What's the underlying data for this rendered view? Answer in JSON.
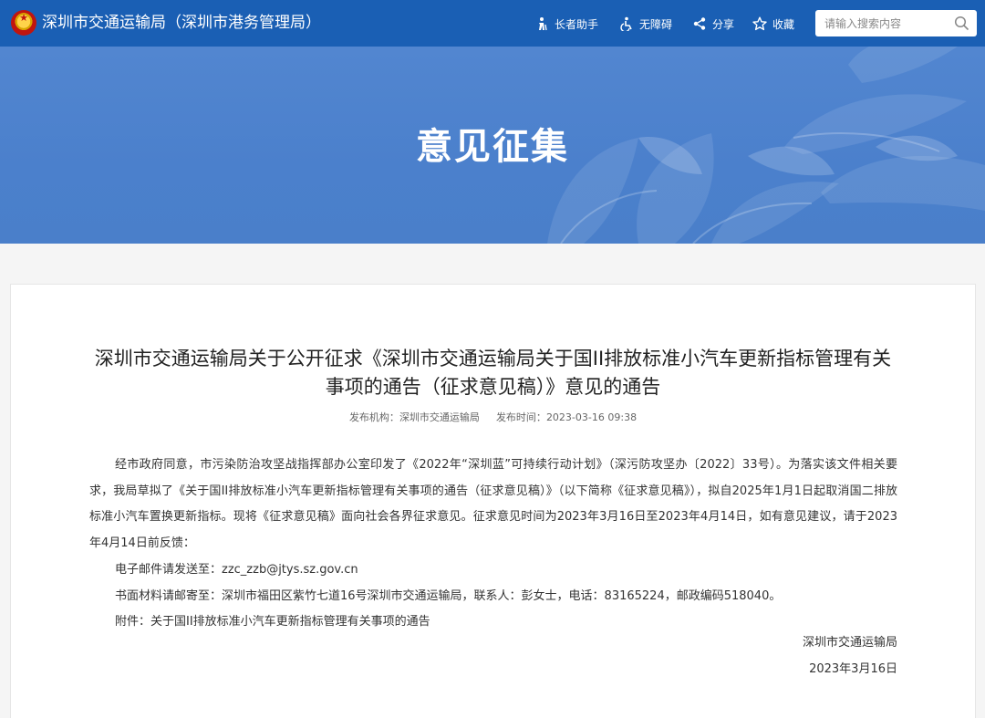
{
  "header": {
    "site_title": "深圳市交通运输局（深圳市港务管理局）",
    "tools": [
      {
        "label": "长者助手",
        "icon": "elder-assist-icon"
      },
      {
        "label": "无障碍",
        "icon": "accessibility-icon"
      },
      {
        "label": "分享",
        "icon": "share-icon"
      },
      {
        "label": "收藏",
        "icon": "star-icon"
      }
    ],
    "search": {
      "placeholder": "请输入搜索内容"
    }
  },
  "banner": {
    "title": "意见征集"
  },
  "article": {
    "title_line1": "深圳市交通运输局关于公开征求《深圳市交通运输局关于国II排放标准小汽车更新指标管理有关",
    "title_line2": "事项的通告（征求意见稿）》意见的通告",
    "publisher_label": "发布机构：",
    "publisher": "深圳市交通运输局",
    "time_label": "发布时间：",
    "time": "2023-03-16 09:38",
    "paragraph": "经市政府同意，市污染防治攻坚战指挥部办公室印发了《2022年“深圳蓝”可持续行动计划》（深污防攻坚办〔2022〕33号）。为落实该文件相关要求，我局草拟了《关于国II排放标准小汽车更新指标管理有关事项的通告（征求意见稿）》（以下简称《征求意见稿》），拟自2025年1月1日起取消国二排放标准小汽车置换更新指标。现将《征求意见稿》面向社会各界征求意见。征求意见时间为2023年3月16日至2023年4月14日，如有意见建议，请于2023年4月14日前反馈：",
    "email_line": "电子邮件请发送至：zzc_zzb@jtys.sz.gov.cn",
    "mail_line": "书面材料请邮寄至：深圳市福田区紫竹七道16号深圳市交通运输局，联系人：彭女士，电话：83165224，邮政编码518040。",
    "attachment_line": "附件：关于国II排放标准小汽车更新指标管理有关事项的通告",
    "sign_org": "深圳市交通运输局",
    "sign_date": "2023年3月16日"
  },
  "colors": {
    "header_bg": "#1a5fb4",
    "banner_bg": "#4b80cc"
  }
}
